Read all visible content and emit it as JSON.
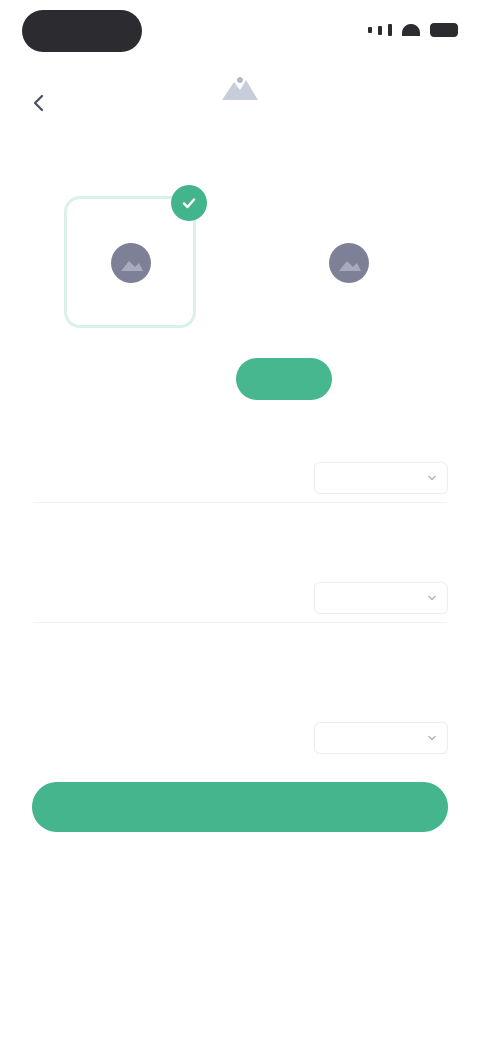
{
  "header": {
    "title": ""
  },
  "images": [
    {
      "label": "",
      "selected": true
    },
    {
      "label": "",
      "selected": false
    }
  ],
  "toggle": {
    "options": [
      {
        "label": "",
        "active": false
      },
      {
        "label": "",
        "active": true
      }
    ]
  },
  "fields": [
    {
      "label": "",
      "value": "",
      "option": ""
    },
    {
      "label": "",
      "value": "",
      "option": ""
    },
    {
      "label": "",
      "value": "",
      "option": ""
    }
  ],
  "helper_texts": [
    "",
    ""
  ],
  "primary_button": {
    "label": ""
  },
  "colors": {
    "accent": "#45b58e",
    "accent_light": "#d8f2e7",
    "title": "#3b3e63",
    "text_muted": "#a7acbd"
  },
  "icons": {
    "back": "back-arrow-icon",
    "logo": "logo-icon",
    "image_placeholder": "image-placeholder-icon",
    "check": "check-icon",
    "chevron": "chevron-down-icon"
  }
}
